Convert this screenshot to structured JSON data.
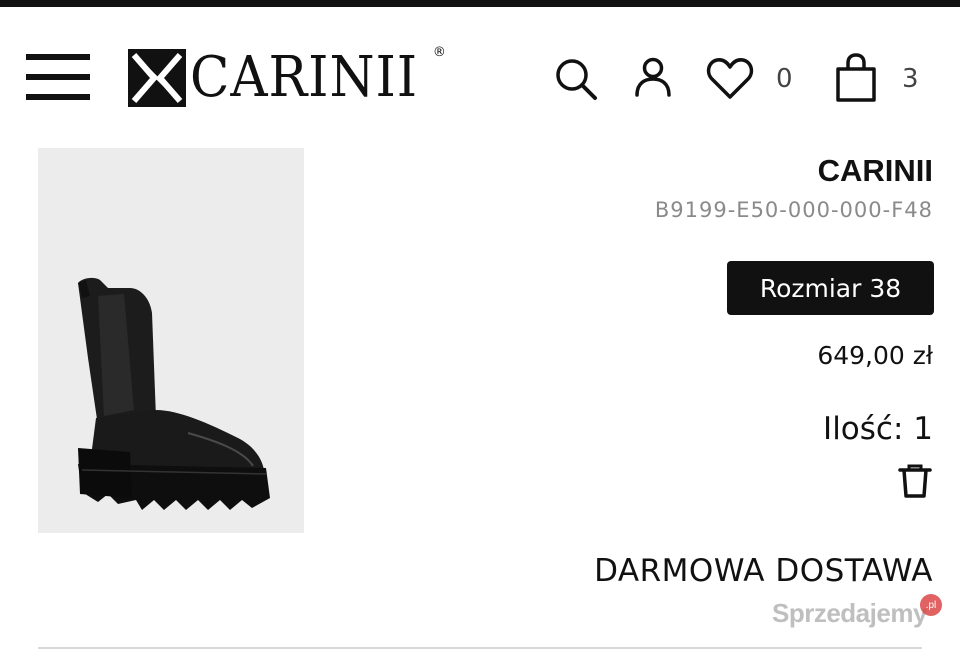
{
  "header": {
    "logo_text": "CARINII",
    "logo_reg": "®",
    "favorites_count": "0",
    "cart_count": "3"
  },
  "product": {
    "brand": "CARINII",
    "sku": "B9199-E50-000-000-F48",
    "size_label": "Rozmiar 38",
    "price": "649,00 zł",
    "quantity_label": "Ilość: 1",
    "image_alt": "black chelsea boot"
  },
  "shipping": {
    "label": "DARMOWA DOSTAWA"
  },
  "watermark": {
    "text": "Sprzedajemy",
    "badge": ".pl"
  },
  "icons": {
    "menu": "hamburger-icon",
    "search": "search-icon",
    "account": "user-icon",
    "favorites": "heart-icon",
    "cart": "shopping-bag-icon",
    "remove": "trash-icon"
  },
  "colors": {
    "text": "#111111",
    "muted": "#8a8a8a",
    "badge_bg": "#111111",
    "badge_text": "#ffffff",
    "image_bg": "#ececec"
  }
}
